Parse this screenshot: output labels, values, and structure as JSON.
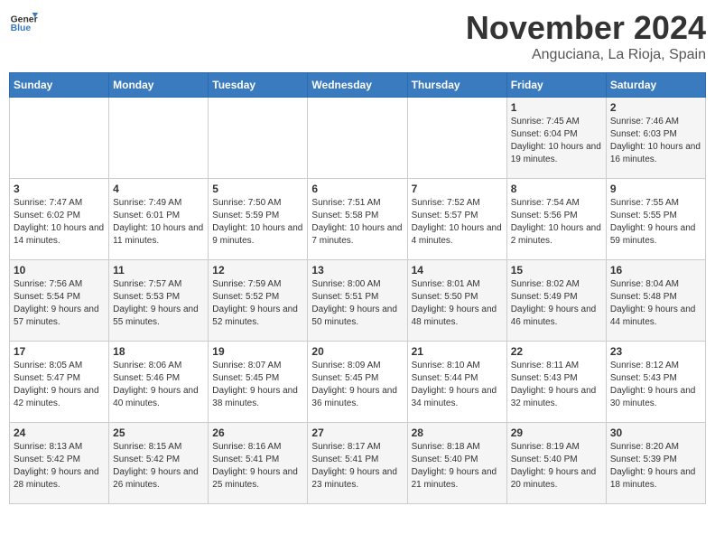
{
  "logo": {
    "line1": "General",
    "line2": "Blue"
  },
  "title": "November 2024",
  "location": "Anguciana, La Rioja, Spain",
  "days_of_week": [
    "Sunday",
    "Monday",
    "Tuesday",
    "Wednesday",
    "Thursday",
    "Friday",
    "Saturday"
  ],
  "weeks": [
    [
      {
        "day": "",
        "info": ""
      },
      {
        "day": "",
        "info": ""
      },
      {
        "day": "",
        "info": ""
      },
      {
        "day": "",
        "info": ""
      },
      {
        "day": "",
        "info": ""
      },
      {
        "day": "1",
        "info": "Sunrise: 7:45 AM\nSunset: 6:04 PM\nDaylight: 10 hours and 19 minutes."
      },
      {
        "day": "2",
        "info": "Sunrise: 7:46 AM\nSunset: 6:03 PM\nDaylight: 10 hours and 16 minutes."
      }
    ],
    [
      {
        "day": "3",
        "info": "Sunrise: 7:47 AM\nSunset: 6:02 PM\nDaylight: 10 hours and 14 minutes."
      },
      {
        "day": "4",
        "info": "Sunrise: 7:49 AM\nSunset: 6:01 PM\nDaylight: 10 hours and 11 minutes."
      },
      {
        "day": "5",
        "info": "Sunrise: 7:50 AM\nSunset: 5:59 PM\nDaylight: 10 hours and 9 minutes."
      },
      {
        "day": "6",
        "info": "Sunrise: 7:51 AM\nSunset: 5:58 PM\nDaylight: 10 hours and 7 minutes."
      },
      {
        "day": "7",
        "info": "Sunrise: 7:52 AM\nSunset: 5:57 PM\nDaylight: 10 hours and 4 minutes."
      },
      {
        "day": "8",
        "info": "Sunrise: 7:54 AM\nSunset: 5:56 PM\nDaylight: 10 hours and 2 minutes."
      },
      {
        "day": "9",
        "info": "Sunrise: 7:55 AM\nSunset: 5:55 PM\nDaylight: 9 hours and 59 minutes."
      }
    ],
    [
      {
        "day": "10",
        "info": "Sunrise: 7:56 AM\nSunset: 5:54 PM\nDaylight: 9 hours and 57 minutes."
      },
      {
        "day": "11",
        "info": "Sunrise: 7:57 AM\nSunset: 5:53 PM\nDaylight: 9 hours and 55 minutes."
      },
      {
        "day": "12",
        "info": "Sunrise: 7:59 AM\nSunset: 5:52 PM\nDaylight: 9 hours and 52 minutes."
      },
      {
        "day": "13",
        "info": "Sunrise: 8:00 AM\nSunset: 5:51 PM\nDaylight: 9 hours and 50 minutes."
      },
      {
        "day": "14",
        "info": "Sunrise: 8:01 AM\nSunset: 5:50 PM\nDaylight: 9 hours and 48 minutes."
      },
      {
        "day": "15",
        "info": "Sunrise: 8:02 AM\nSunset: 5:49 PM\nDaylight: 9 hours and 46 minutes."
      },
      {
        "day": "16",
        "info": "Sunrise: 8:04 AM\nSunset: 5:48 PM\nDaylight: 9 hours and 44 minutes."
      }
    ],
    [
      {
        "day": "17",
        "info": "Sunrise: 8:05 AM\nSunset: 5:47 PM\nDaylight: 9 hours and 42 minutes."
      },
      {
        "day": "18",
        "info": "Sunrise: 8:06 AM\nSunset: 5:46 PM\nDaylight: 9 hours and 40 minutes."
      },
      {
        "day": "19",
        "info": "Sunrise: 8:07 AM\nSunset: 5:45 PM\nDaylight: 9 hours and 38 minutes."
      },
      {
        "day": "20",
        "info": "Sunrise: 8:09 AM\nSunset: 5:45 PM\nDaylight: 9 hours and 36 minutes."
      },
      {
        "day": "21",
        "info": "Sunrise: 8:10 AM\nSunset: 5:44 PM\nDaylight: 9 hours and 34 minutes."
      },
      {
        "day": "22",
        "info": "Sunrise: 8:11 AM\nSunset: 5:43 PM\nDaylight: 9 hours and 32 minutes."
      },
      {
        "day": "23",
        "info": "Sunrise: 8:12 AM\nSunset: 5:43 PM\nDaylight: 9 hours and 30 minutes."
      }
    ],
    [
      {
        "day": "24",
        "info": "Sunrise: 8:13 AM\nSunset: 5:42 PM\nDaylight: 9 hours and 28 minutes."
      },
      {
        "day": "25",
        "info": "Sunrise: 8:15 AM\nSunset: 5:42 PM\nDaylight: 9 hours and 26 minutes."
      },
      {
        "day": "26",
        "info": "Sunrise: 8:16 AM\nSunset: 5:41 PM\nDaylight: 9 hours and 25 minutes."
      },
      {
        "day": "27",
        "info": "Sunrise: 8:17 AM\nSunset: 5:41 PM\nDaylight: 9 hours and 23 minutes."
      },
      {
        "day": "28",
        "info": "Sunrise: 8:18 AM\nSunset: 5:40 PM\nDaylight: 9 hours and 21 minutes."
      },
      {
        "day": "29",
        "info": "Sunrise: 8:19 AM\nSunset: 5:40 PM\nDaylight: 9 hours and 20 minutes."
      },
      {
        "day": "30",
        "info": "Sunrise: 8:20 AM\nSunset: 5:39 PM\nDaylight: 9 hours and 18 minutes."
      }
    ]
  ]
}
